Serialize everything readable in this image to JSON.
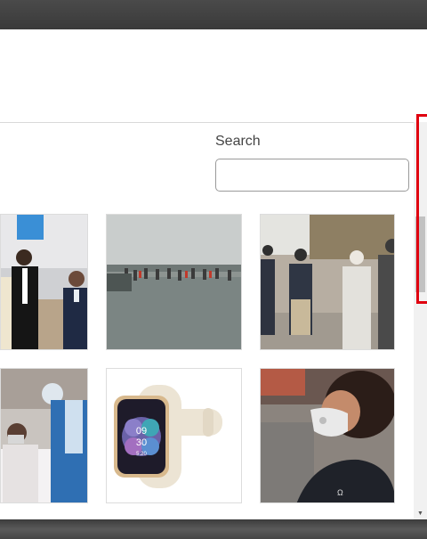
{
  "search": {
    "label": "Search",
    "placeholder": "",
    "value": ""
  },
  "gallery": {
    "items": [
      {
        "subject": "officials in suits and masks at a meeting"
      },
      {
        "subject": "crowd standing in flood water"
      },
      {
        "subject": "police officers and man in white clothing"
      },
      {
        "subject": "patient on hospital bed with health worker in PPE"
      },
      {
        "subject": "smartwatch product"
      },
      {
        "subject": "woman wearing face mask"
      }
    ]
  },
  "watch_face": {
    "hour": "09",
    "minute": "30",
    "date": "5.20"
  },
  "colors": {
    "highlight": "#e0000f",
    "top_bar": "#3a3a3a"
  }
}
